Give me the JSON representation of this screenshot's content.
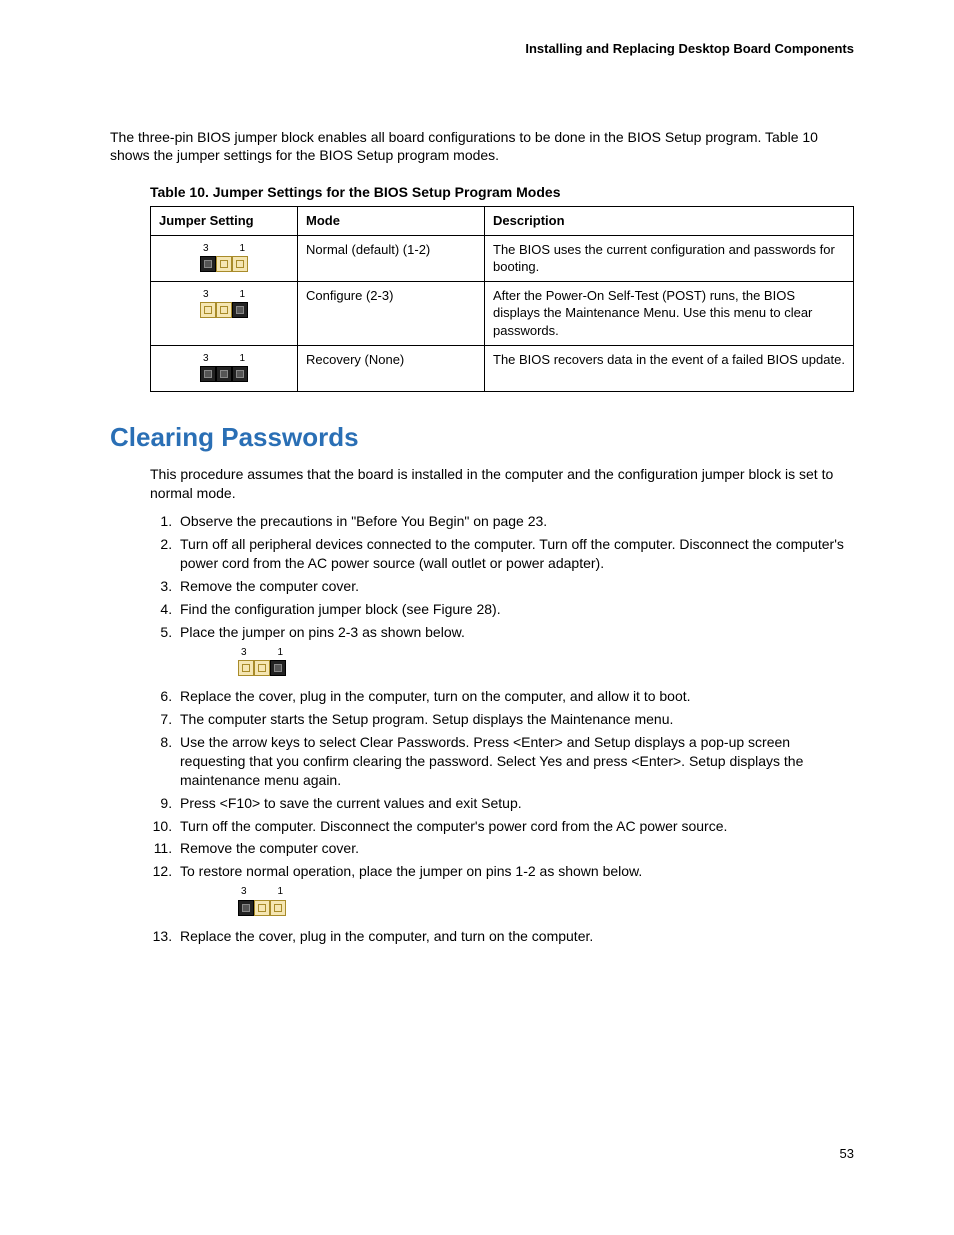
{
  "header": {
    "title": "Installing and Replacing Desktop Board Components"
  },
  "intro": "The three-pin BIOS jumper block enables all board configurations to be done in the BIOS Setup program.  Table 10 shows the jumper settings for the BIOS Setup program modes.",
  "table": {
    "title": "Table 10. Jumper Settings for the BIOS Setup Program Modes",
    "headers": {
      "jumper": "Jumper Setting",
      "mode": "Mode",
      "desc": "Description"
    },
    "pin_label_left": "3",
    "pin_label_right": "1",
    "rows": [
      {
        "mode": "Normal (default) (1-2)",
        "desc": "The BIOS uses the current configuration and passwords for booting."
      },
      {
        "mode": "Configure (2-3)",
        "desc": "After the Power-On Self-Test (POST) runs, the BIOS displays the Maintenance Menu.  Use this menu to clear passwords."
      },
      {
        "mode": "Recovery (None)",
        "desc": "The BIOS recovers data in the event of a failed BIOS update."
      }
    ]
  },
  "section": {
    "heading": "Clearing Passwords",
    "intro": "This procedure assumes that the board is installed in the computer and the configuration jumper block is set to normal mode.",
    "steps": [
      "Observe the precautions in \"Before You Begin\" on page 23.",
      "Turn off all peripheral devices connected to the computer.  Turn off the computer.  Disconnect the computer's power cord from the AC power source (wall outlet or power adapter).",
      "Remove the computer cover.",
      "Find the configuration jumper block (see Figure 28).",
      "Place the jumper on pins 2-3 as shown below.",
      "Replace the cover, plug in the computer, turn on the computer, and allow it to boot.",
      "The computer starts the Setup program.  Setup displays the Maintenance menu.",
      "Use the arrow keys to select Clear Passwords.  Press <Enter> and Setup displays a pop-up screen requesting that you confirm clearing the password.  Select Yes and press <Enter>.  Setup displays the maintenance menu again.",
      "Press <F10> to save the current values and exit Setup.",
      "Turn off the computer.  Disconnect the computer's power cord from the AC power source.",
      "Remove the computer cover.",
      "To restore normal operation, place the jumper on pins 1-2 as shown below.",
      "Replace the cover, plug in the computer, and turn on the computer."
    ]
  },
  "page_number": "53"
}
